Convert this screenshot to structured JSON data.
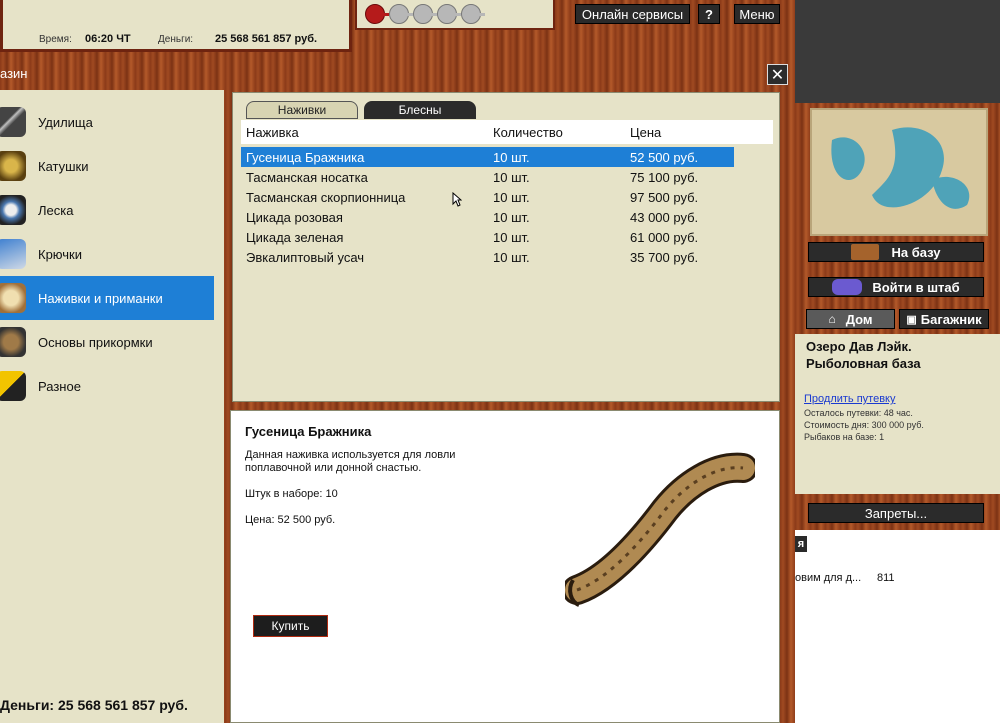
{
  "status": {
    "time_label": "Время:",
    "time_value": "06:20 ЧТ",
    "money_label": "Деньги:",
    "money_value": "25 568 561 857 руб."
  },
  "topbar": {
    "online_label": "Онлайн сервисы",
    "help_label": "?",
    "menu_label": "Меню"
  },
  "window": {
    "title": "азин",
    "close_label": "✕"
  },
  "categories": [
    {
      "label": "Удилища",
      "icon": "rod-icon"
    },
    {
      "label": "Катушки",
      "icon": "reel-icon"
    },
    {
      "label": "Леска",
      "icon": "line-icon"
    },
    {
      "label": "Крючки",
      "icon": "hook-icon"
    },
    {
      "label": "Наживки и приманки",
      "icon": "bait-icon"
    },
    {
      "label": "Основы прикормки",
      "icon": "groundbait-icon"
    },
    {
      "label": "Разное",
      "icon": "misc-icon"
    }
  ],
  "left_money": "Деньги: 25 568 561 857 руб.",
  "tabs": {
    "baits": "Наживки",
    "lures": "Блесны"
  },
  "table": {
    "headers": [
      "Наживка",
      "Количество",
      "Цена"
    ],
    "rows": [
      [
        "Гусеница Бражника",
        "10 шт.",
        "52 500 руб."
      ],
      [
        "Тасманская носатка",
        "10 шт.",
        "75 100 руб."
      ],
      [
        "Тасманская скорпионница",
        "10 шт.",
        "97 500 руб."
      ],
      [
        "Цикада розовая",
        "10 шт.",
        "43 000 руб."
      ],
      [
        "Цикада зеленая",
        "10 шт.",
        "61 000 руб."
      ],
      [
        "Эвкалиптовый усач",
        "10 шт.",
        "35 700 руб."
      ]
    ]
  },
  "detail": {
    "name": "Гусеница Бражника",
    "description": "Данная наживка используется для ловли поплавочной или донной снастью.",
    "pack": "Штук в наборе: 10",
    "price": "Цена: 52 500 руб.",
    "buy_label": "Купить"
  },
  "right": {
    "to_base": "На базу",
    "to_hq": "Войти в штаб",
    "home_tab": "Дом",
    "trunk_tab": "Багажник",
    "location_line1": "Озеро Дав Лэйк.",
    "location_line2": "Рыболовная база",
    "extend_link": "Продлить путевку",
    "remaining": "Осталось путевки: 48 час.",
    "daily_cost": "Стоимость дня: 300 000 руб.",
    "fishers": "Рыбаков на базе: 1",
    "bans": "Запреты...",
    "partial_header": "я",
    "partial_row_text": "овим для д...",
    "partial_row_num": "811"
  }
}
